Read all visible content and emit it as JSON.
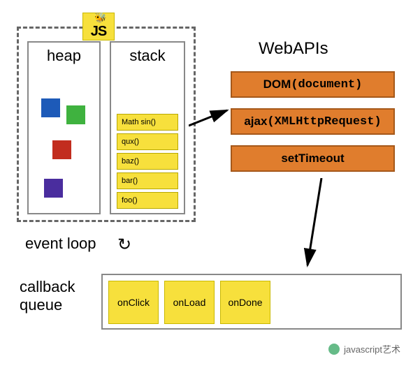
{
  "badge": {
    "text": "JS"
  },
  "runtime": {
    "heap": {
      "label": "heap"
    },
    "stack": {
      "label": "stack",
      "items": [
        "Math sin()",
        "qux()",
        "baz()",
        "bar()",
        "foo()"
      ]
    }
  },
  "webapis": {
    "label": "WebAPIs",
    "items": [
      {
        "prefix": "DOM",
        "detail": "(document)"
      },
      {
        "prefix": "ajax",
        "detail": "(XMLHttpRequest)"
      },
      {
        "prefix": "setTimeout",
        "detail": ""
      }
    ]
  },
  "eventloop": {
    "label": "event loop"
  },
  "callback": {
    "label": "callback queue",
    "items": [
      "onClick",
      "onLoad",
      "onDone"
    ]
  },
  "watermark": {
    "text": "javascript艺术"
  }
}
